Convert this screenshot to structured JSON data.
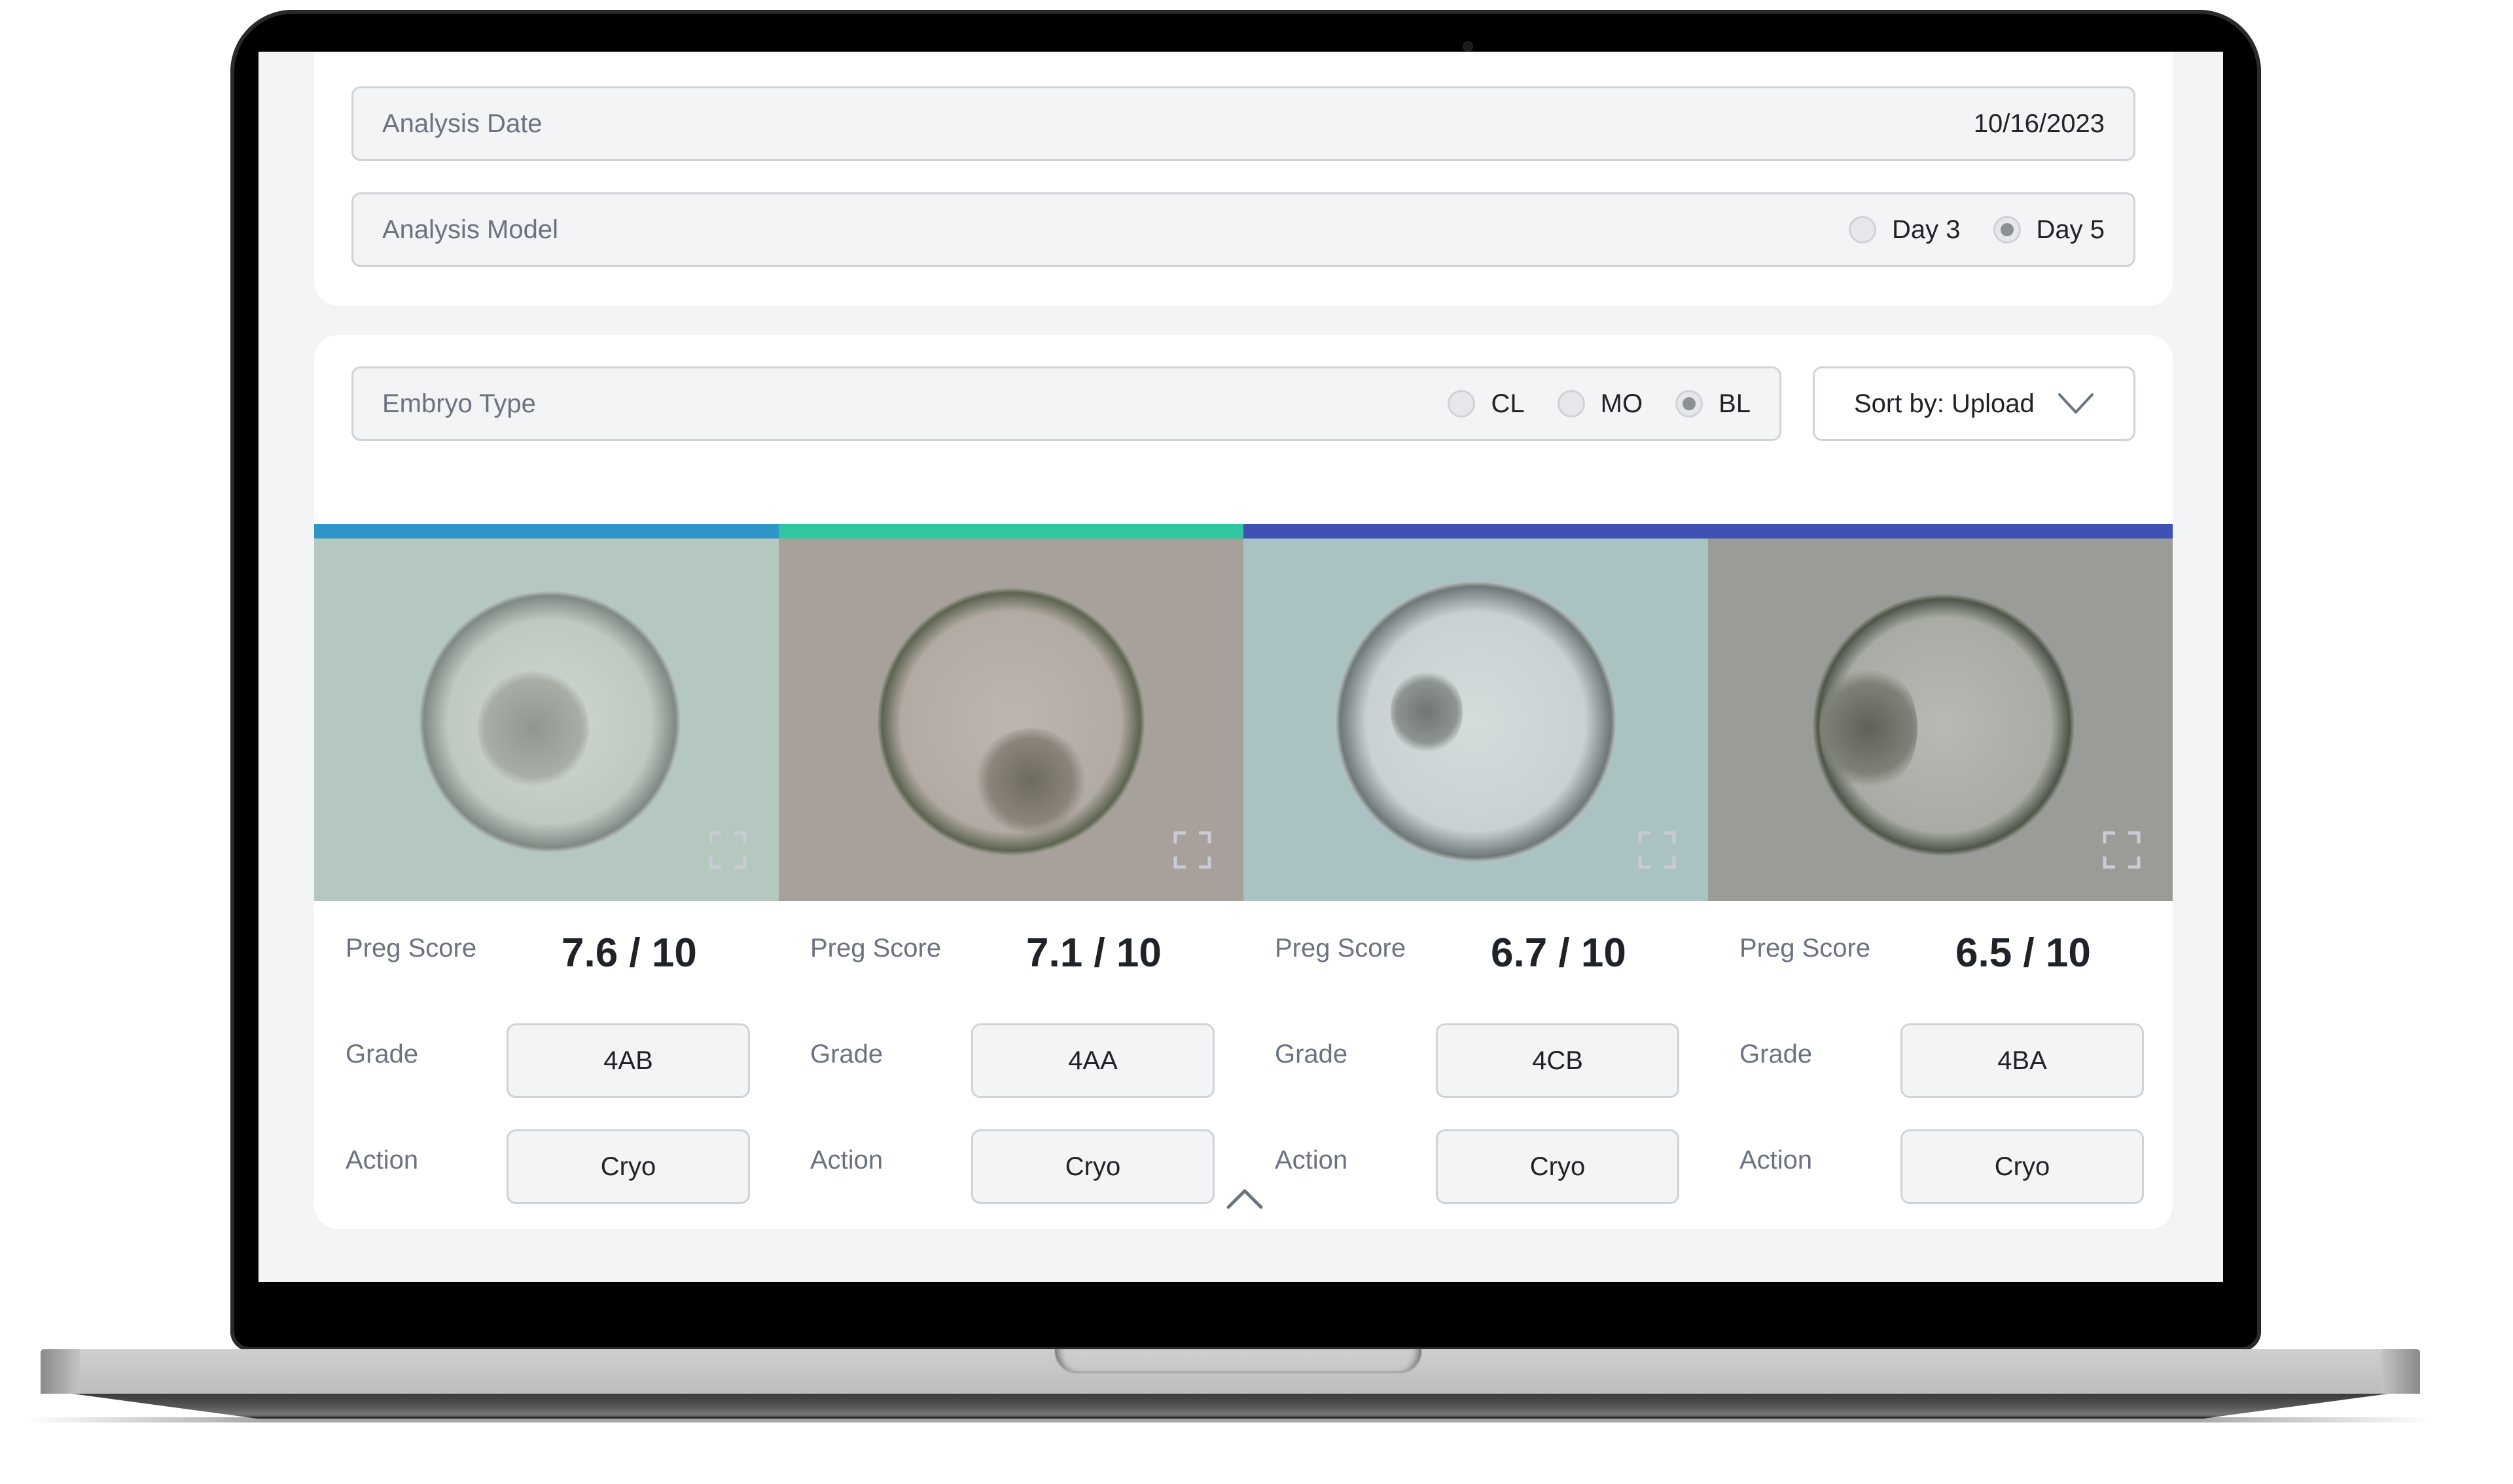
{
  "analysis": {
    "date_label": "Analysis Date",
    "date_value": "10/16/2023",
    "model_label": "Analysis Model",
    "model_options": [
      {
        "label": "Day 3",
        "selected": false
      },
      {
        "label": "Day 5",
        "selected": true
      }
    ]
  },
  "filter": {
    "embryo_type_label": "Embryo Type",
    "embryo_type_options": [
      {
        "label": "CL",
        "selected": false
      },
      {
        "label": "MO",
        "selected": false
      },
      {
        "label": "BL",
        "selected": true
      }
    ],
    "sort_label": "Sort by: Upload",
    "sort_icon": "chevron-down-icon"
  },
  "category_bar_colors": [
    "#2e97c7",
    "#2ec7a2",
    "#3f51b5",
    "#3f51b5"
  ],
  "embryos": [
    {
      "preg_score_label": "Preg Score",
      "preg_score": "7.6 / 10",
      "grade_label": "Grade",
      "grade": "4AB",
      "action_label": "Action",
      "action": "Cryo",
      "image_bg": "#b4c8bf",
      "icon": "expand-icon"
    },
    {
      "preg_score_label": "Preg Score",
      "preg_score": "7.1 / 10",
      "grade_label": "Grade",
      "grade": "4AA",
      "action_label": "Action",
      "action": "Cryo",
      "image_bg": "#a8a19b",
      "icon": "expand-icon"
    },
    {
      "preg_score_label": "Preg Score",
      "preg_score": "6.7 / 10",
      "grade_label": "Grade",
      "grade": "4CB",
      "action_label": "Action",
      "action": "Cryo",
      "image_bg": "#aac3c2",
      "icon": "expand-icon"
    },
    {
      "preg_score_label": "Preg Score",
      "preg_score": "6.5 / 10",
      "grade_label": "Grade",
      "grade": "4BA",
      "action_label": "Action",
      "action": "Cryo",
      "image_bg": "#9a9d97",
      "icon": "expand-icon"
    }
  ],
  "collapse_icon": "chevron-up-icon"
}
